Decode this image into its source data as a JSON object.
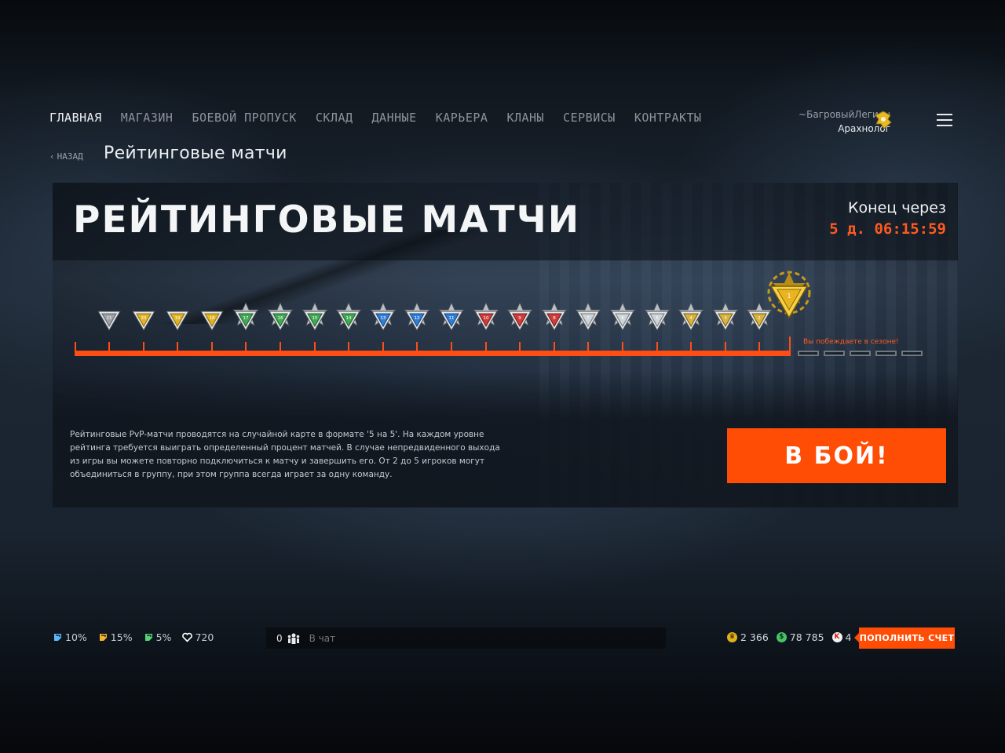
{
  "nav": {
    "items": [
      {
        "label": "ГЛАВНАЯ",
        "active": true
      },
      {
        "label": "МАГАЗИН",
        "active": false
      },
      {
        "label": "БОЕВОЙ ПРОПУСК",
        "active": false
      },
      {
        "label": "СКЛАД",
        "active": false
      },
      {
        "label": "ДАННЫЕ",
        "active": false
      },
      {
        "label": "КАРЬЕРА",
        "active": false
      },
      {
        "label": "КЛАНЫ",
        "active": false
      },
      {
        "label": "СЕРВИСЫ",
        "active": false
      },
      {
        "label": "КОНТРАКТЫ",
        "active": false
      }
    ]
  },
  "profile": {
    "clan": "~БагровыйЛегион",
    "nick": "Арахнолог",
    "rank_icon": "gold-rank-icon"
  },
  "menu_icon": "hamburger-icon",
  "breadcrumb": {
    "back_label": "НАЗАД",
    "title": "Рейтинговые матчи"
  },
  "banner": {
    "title": "РЕЙТИНГОВЫЕ МАТЧИ",
    "timer_label": "Конец через",
    "timer_value": "5 д. 06:15:59",
    "ranks": [
      {
        "num": "21",
        "tier": "gray"
      },
      {
        "num": "20",
        "tier": "gold"
      },
      {
        "num": "19",
        "tier": "gold"
      },
      {
        "num": "18",
        "tier": "gold"
      },
      {
        "num": "17",
        "tier": "green"
      },
      {
        "num": "16",
        "tier": "green"
      },
      {
        "num": "15",
        "tier": "green"
      },
      {
        "num": "14",
        "tier": "green"
      },
      {
        "num": "13",
        "tier": "blue"
      },
      {
        "num": "12",
        "tier": "blue"
      },
      {
        "num": "11",
        "tier": "blue"
      },
      {
        "num": "10",
        "tier": "red"
      },
      {
        "num": "9",
        "tier": "red"
      },
      {
        "num": "8",
        "tier": "red"
      },
      {
        "num": "7",
        "tier": "silver"
      },
      {
        "num": "6",
        "tier": "silver"
      },
      {
        "num": "5",
        "tier": "silver"
      },
      {
        "num": "4",
        "tier": "goldstar"
      },
      {
        "num": "3",
        "tier": "goldstar"
      },
      {
        "num": "2",
        "tier": "goldstar"
      }
    ],
    "current_rank": {
      "num": "1",
      "tier": "elite"
    },
    "season_leading_text": "Вы побеждаете в сезоне!",
    "placement_slots": 5,
    "description": "Рейтинговые PvP-матчи проводятся на случайной карте в формате '5 на 5'. На каждом уровне рейтинга требуется выиграть определенный процент матчей. В случае непредвиденного выхода из игры вы можете повторно подключиться к матчу и завершить его. От 2 до 5 игроков могут объединиться в группу, при этом группа всегда играет за одну команду.",
    "fight_button": "В БОЙ!"
  },
  "bottom": {
    "boosts": [
      {
        "icon": "xp-boost-icon",
        "value": "10%",
        "color": "#5bb8ff"
      },
      {
        "icon": "money-boost-icon",
        "value": "15%",
        "color": "#f0b431"
      },
      {
        "icon": "sp-boost-icon",
        "value": "5%",
        "color": "#58d27a"
      },
      {
        "icon": "vip-heart-icon",
        "value": "720",
        "color": "#ffffff"
      }
    ],
    "chat": {
      "online_count": "0",
      "placeholder": "В чат"
    },
    "wallet": {
      "crowns": "2 366",
      "money": "78 785",
      "kredits": "4"
    },
    "topup_button": "ПОПОЛНИТЬ СЧЕТ"
  },
  "colors": {
    "accent": "#ff4d06",
    "track": "#ff4d14"
  }
}
